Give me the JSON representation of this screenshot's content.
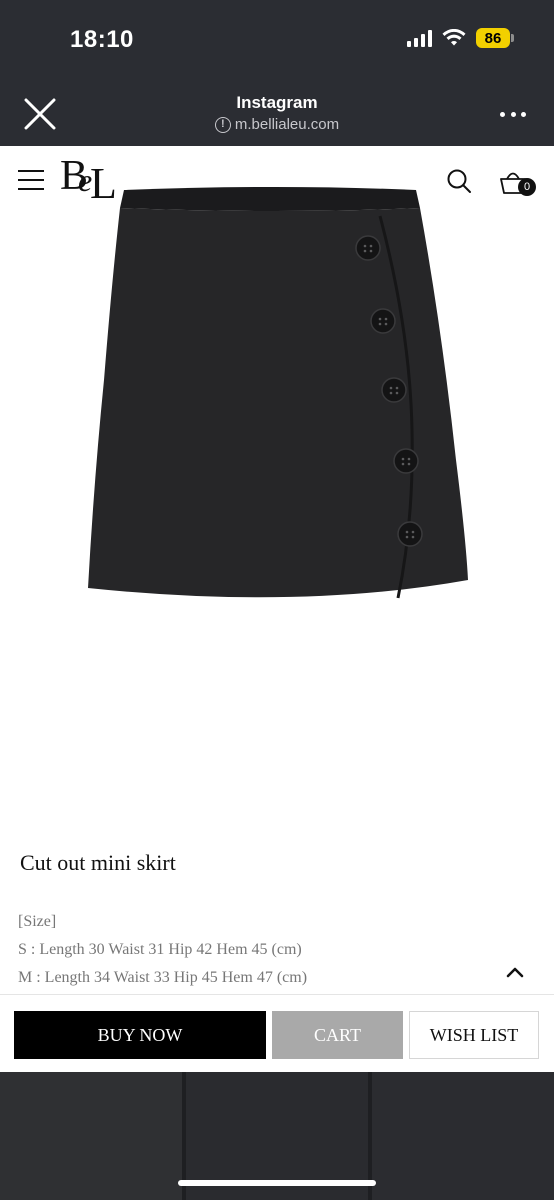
{
  "status_bar": {
    "time": "18:10",
    "battery": "86"
  },
  "browser": {
    "title": "Instagram",
    "url": "m.bellialeu.com"
  },
  "shop_header": {
    "logo_text": "BeL",
    "cart_count": "0"
  },
  "product": {
    "title": "Cut out mini skirt",
    "size_heading": "[Size]",
    "size_s": "S : Length 30 Waist 31 Hip 42 Hem 45 (cm)",
    "size_m": "M : Length 34 Waist 33 Hip 45 Hem 47 (cm)"
  },
  "actions": {
    "buy_now": "BUY NOW",
    "cart": "CART",
    "wish_list": "WISH LIST"
  },
  "icons": {
    "close": "close-icon",
    "info": "info-icon",
    "more": "more-dots-icon",
    "menu": "hamburger-icon",
    "search": "search-icon",
    "cart": "basket-icon",
    "scroll_up": "chevron-up-icon",
    "scroll_down": "chevron-down-icon"
  },
  "colors": {
    "chrome_bg": "#2b2d33",
    "battery": "#f2d000",
    "buy_now_bg": "#000000",
    "cart_bg": "#a9a9a9"
  }
}
